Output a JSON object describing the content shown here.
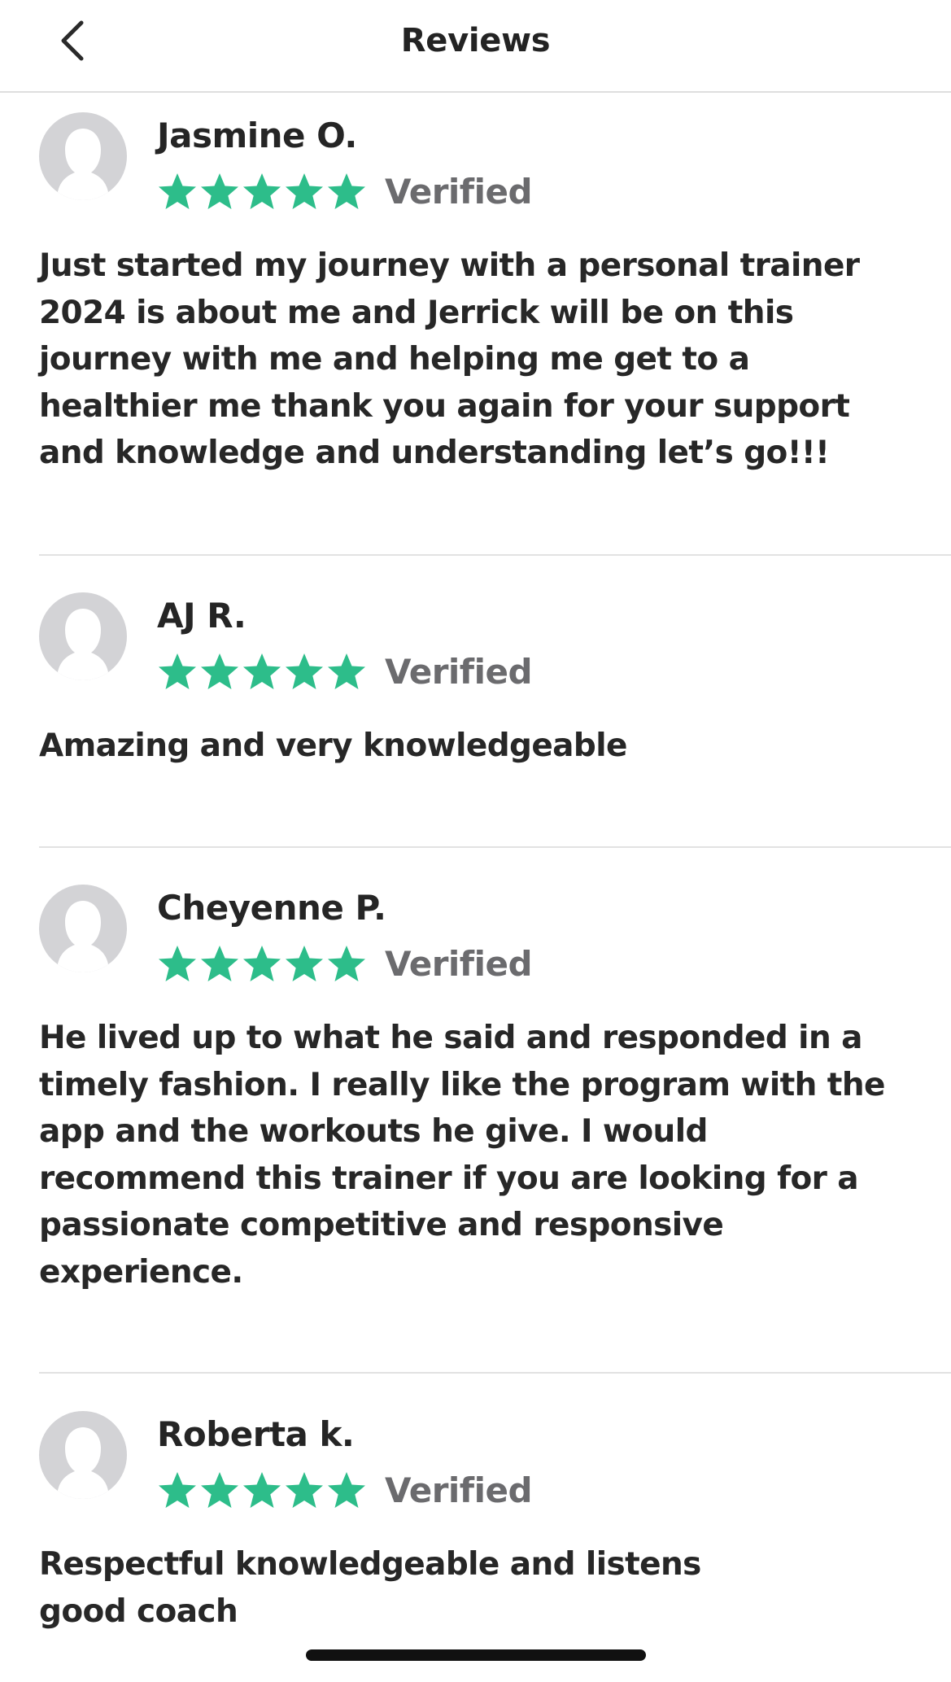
{
  "header": {
    "title": "Reviews",
    "back_icon": "chevron-left-icon"
  },
  "colors": {
    "star": "#2dbd8a",
    "verified": "#6b6b6e",
    "avatar_bg": "#d3d3d6",
    "divider": "#e2e2e2"
  },
  "reviews": [
    {
      "name": "Jasmine O.",
      "rating": 5,
      "badge": "Verified",
      "text": "Just started my journey with a personal trainer\n2024 is about me and Jerrick will be on this\njourney with me and helping me get to a\nhealthier me thank you again for your support\nand knowledge and understanding let’s go!!!"
    },
    {
      "name": "AJ R.",
      "rating": 5,
      "badge": "Verified",
      "text": "Amazing and very knowledgeable"
    },
    {
      "name": "Cheyenne P.",
      "rating": 5,
      "badge": "Verified",
      "text": "He lived up to what he said and responded in a\ntimely fashion. I really like the program with the\napp and the workouts he give. I would\nrecommend this trainer if you are looking for a\npassionate competitive and responsive\nexperience."
    },
    {
      "name": "Roberta k.",
      "rating": 5,
      "badge": "Verified",
      "text": "Respectful knowledgeable and listens\ngood coach"
    }
  ]
}
